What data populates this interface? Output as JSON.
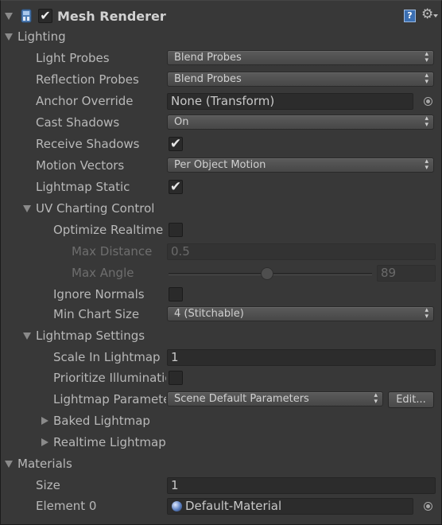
{
  "component": {
    "title": "Mesh Renderer",
    "icons": [
      "mesh-renderer-icon",
      "help-icon",
      "gear-icon"
    ]
  },
  "lighting": {
    "header": "Lighting",
    "light_probes_label": "Light Probes",
    "light_probes_value": "Blend Probes",
    "reflection_probes_label": "Reflection Probes",
    "reflection_probes_value": "Blend Probes",
    "anchor_override_label": "Anchor Override",
    "anchor_override_value": "None (Transform)",
    "cast_shadows_label": "Cast Shadows",
    "cast_shadows_value": "On",
    "receive_shadows_label": "Receive Shadows",
    "receive_shadows_checked": true,
    "motion_vectors_label": "Motion Vectors",
    "motion_vectors_value": "Per Object Motion",
    "lightmap_static_label": "Lightmap Static",
    "lightmap_static_checked": true
  },
  "uv_charting": {
    "header": "UV Charting Control",
    "optimize_label": "Optimize Realtime",
    "max_distance_label": "Max Distance",
    "max_distance_value": "0.5",
    "max_angle_label": "Max Angle",
    "max_angle_value": "89",
    "ignore_normals_label": "Ignore Normals",
    "min_chart_size_label": "Min Chart Size",
    "min_chart_size_value": "4 (Stitchable)"
  },
  "lightmap_settings": {
    "header": "Lightmap Settings",
    "scale_label": "Scale In Lightmap",
    "scale_value": "1",
    "prioritize_label": "Prioritize Illumination",
    "params_label": "Lightmap Parameters",
    "params_value": "Scene Default Parameters",
    "edit_button": "Edit...",
    "baked_label": "Baked Lightmap",
    "realtime_label": "Realtime Lightmap"
  },
  "materials": {
    "header": "Materials",
    "size_label": "Size",
    "size_value": "1",
    "element0_label": "Element 0",
    "element0_value": "Default-Material"
  }
}
